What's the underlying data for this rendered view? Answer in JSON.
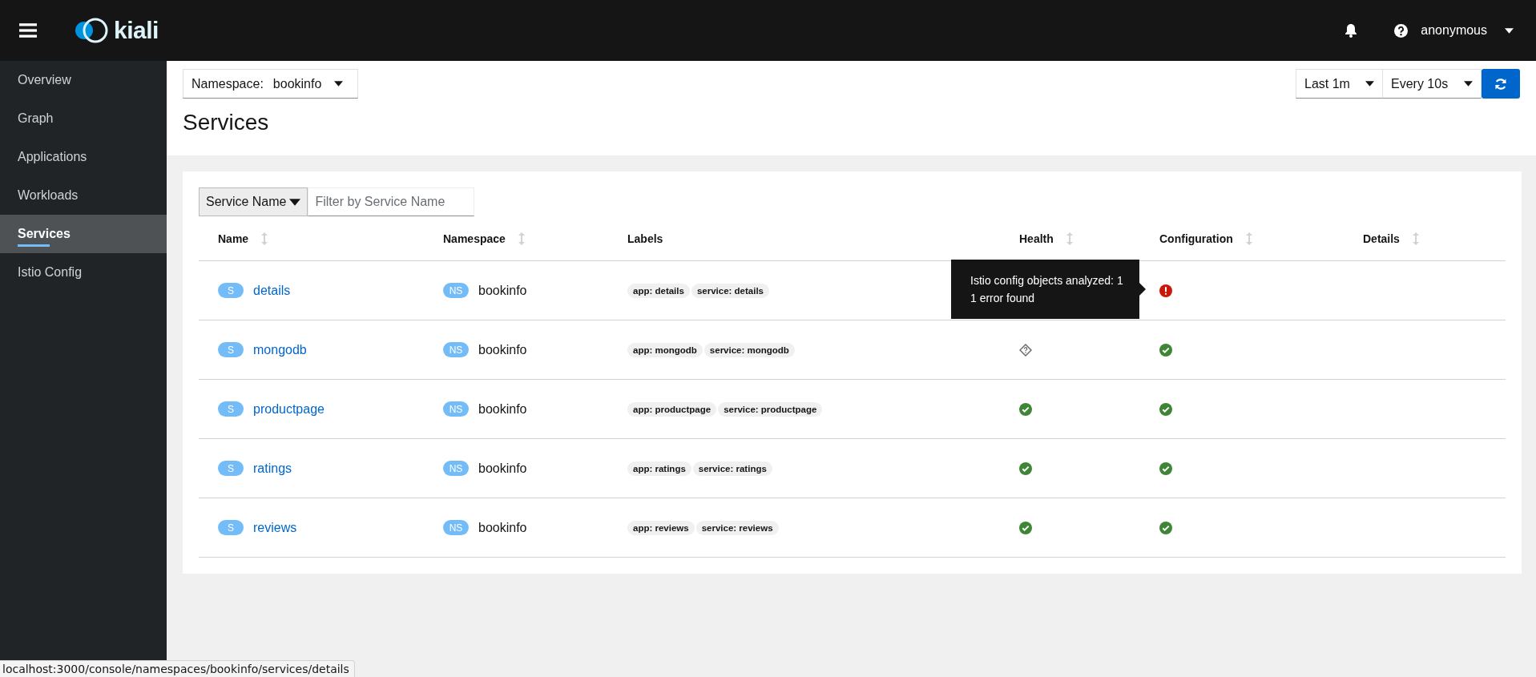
{
  "brand": "kiali",
  "masthead": {
    "user": "anonymous"
  },
  "sidebar": {
    "items": [
      {
        "label": "Overview",
        "selected": false
      },
      {
        "label": "Graph",
        "selected": false
      },
      {
        "label": "Applications",
        "selected": false
      },
      {
        "label": "Workloads",
        "selected": false
      },
      {
        "label": "Services",
        "selected": true
      },
      {
        "label": "Istio Config",
        "selected": false
      }
    ]
  },
  "namespace_select": {
    "label": "Namespace:",
    "value": "bookinfo"
  },
  "time_range": "Last 1m",
  "refresh_interval": "Every 10s",
  "page_title": "Services",
  "filter": {
    "type": "Service Name",
    "placeholder": "Filter by Service Name"
  },
  "table": {
    "columns": [
      {
        "label": "Name",
        "sortable": true
      },
      {
        "label": "Namespace",
        "sortable": true
      },
      {
        "label": "Labels",
        "sortable": false
      },
      {
        "label": "Health",
        "sortable": true
      },
      {
        "label": "Configuration",
        "sortable": true
      },
      {
        "label": "Details",
        "sortable": true
      }
    ],
    "rows": [
      {
        "badge": "S",
        "name": "details",
        "ns_badge": "NS",
        "namespace": "bookinfo",
        "labels": [
          "app: details",
          "service: details"
        ],
        "config": {
          "kind": "error"
        }
      },
      {
        "badge": "S",
        "name": "mongodb",
        "ns_badge": "NS",
        "namespace": "bookinfo",
        "labels": [
          "app: mongodb",
          "service: mongodb"
        ],
        "health": {
          "kind": "unknown"
        },
        "config": {
          "kind": "valid"
        }
      },
      {
        "badge": "S",
        "name": "productpage",
        "ns_badge": "NS",
        "namespace": "bookinfo",
        "labels": [
          "app: productpage",
          "service: productpage"
        ],
        "health": {
          "kind": "healthy"
        },
        "config": {
          "kind": "valid"
        }
      },
      {
        "badge": "S",
        "name": "ratings",
        "ns_badge": "NS",
        "namespace": "bookinfo",
        "labels": [
          "app: ratings",
          "service: ratings"
        ],
        "health": {
          "kind": "healthy"
        },
        "config": {
          "kind": "valid"
        }
      },
      {
        "badge": "S",
        "name": "reviews",
        "ns_badge": "NS",
        "namespace": "bookinfo",
        "labels": [
          "app: reviews",
          "service: reviews"
        ],
        "health": {
          "kind": "healthy"
        },
        "config": {
          "kind": "valid"
        }
      }
    ]
  },
  "tooltip": [
    "Istio config objects analyzed: 1",
    "1 error found"
  ],
  "status_url": "localhost:3000/console/namespaces/bookinfo/services/details"
}
